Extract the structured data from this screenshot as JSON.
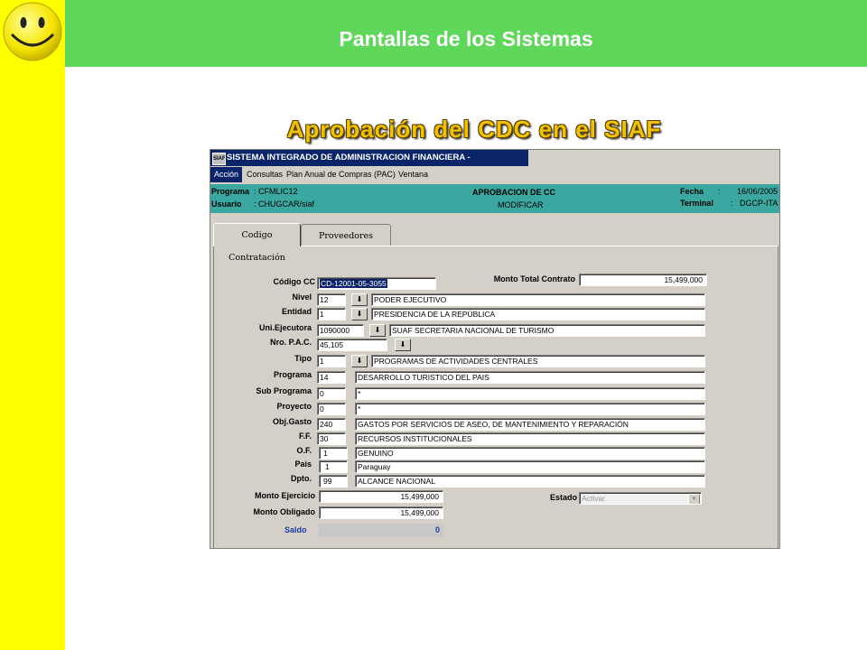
{
  "slide": {
    "header_title": "Pantallas de los Sistemas",
    "subtitle": "Aprobación del CDC en el SIAF",
    "colors": {
      "header": "#5fd75a",
      "sidebar": "#ffff00",
      "subtitle": "#f2c200",
      "window_title": "#0a246a",
      "info_bar": "#3aa8a0"
    }
  },
  "window": {
    "app_icon": "SIAF",
    "title": "SISTEMA INTEGRADO DE ADMINISTRACION FINANCIERA -",
    "menu": [
      "Acción",
      "Consultas",
      "Plan Anual de Compras (PAC)",
      "Ventana"
    ]
  },
  "info": {
    "programa_label": "Programa",
    "programa_value": ": CFMLIC12",
    "usuario_label": "Usuario",
    "usuario_value": ": CHUGCAR/siaf",
    "screen_title": "APROBACION DE CC",
    "mode": "MODIFICAR",
    "fecha_label": "Fecha",
    "fecha_sep": ":",
    "fecha_value": "16/06/2005",
    "terminal_label": "Terminal",
    "terminal_sep": ":",
    "terminal_value": "DGCP-ITA"
  },
  "tabs": [
    "Codigo Contratación",
    "Proveedores"
  ],
  "form": {
    "codigo_cc_label": "Código CC",
    "codigo_cc": "CD-12001-05-3055",
    "monto_total_label": "Monto Total Contrato",
    "monto_total": "15,499,000",
    "nivel_label": "Nivel",
    "nivel_code": "12",
    "nivel_desc": "PODER EJECUTIVO",
    "entidad_label": "Entidad",
    "entidad_code": "1",
    "entidad_desc": "PRESIDENCIA DE LA REPÚBLICA",
    "uni_label": "Uni.Ejecutora",
    "uni_code": "1090000",
    "uni_desc": "SUAF SECRETARIA NACIONAL DE TURISMO",
    "pac_label": "Nro. P.A.C.",
    "pac_code": "45,105",
    "tipo_label": "Tipo",
    "tipo_code": "1",
    "tipo_desc": "PROGRAMAS DE ACTIVIDADES CENTRALES",
    "programa_label": "Programa",
    "programa_code": "14",
    "programa_desc": "DESARROLLO TURISTICO DEL PAIS",
    "subprograma_label": "Sub Programa",
    "subprograma_code": "0",
    "subprograma_desc": "*",
    "proyecto_label": "Proyecto",
    "proyecto_code": "0",
    "proyecto_desc": "*",
    "objgasto_label": "Obj.Gasto",
    "objgasto_code": "240",
    "objgasto_desc": "GASTOS POR SERVICIOS DE ASEO, DE MANTENIMIENTO Y REPARACIÓN",
    "ff_label": "F.F.",
    "ff_code": "30",
    "ff_desc": "RECURSOS INSTITUCIONALES",
    "of_label": "O.F.",
    "of_code": "1",
    "of_desc": "GENUINO",
    "pais_label": "Pais",
    "pais_code": "1",
    "pais_desc": "Paraguay",
    "dpto_label": "Dpto.",
    "dpto_code": "99",
    "dpto_desc": "ALCANCE NACIONAL",
    "monto_ejercicio_label": "Monto Ejercicio",
    "monto_ejercicio": "15,499,000",
    "monto_obligado_label": "Monto Obligado",
    "monto_obligado": "15,499,000",
    "saldo_label": "Saldo",
    "saldo": "0",
    "estado_label": "Estado",
    "estado": "Activar"
  }
}
